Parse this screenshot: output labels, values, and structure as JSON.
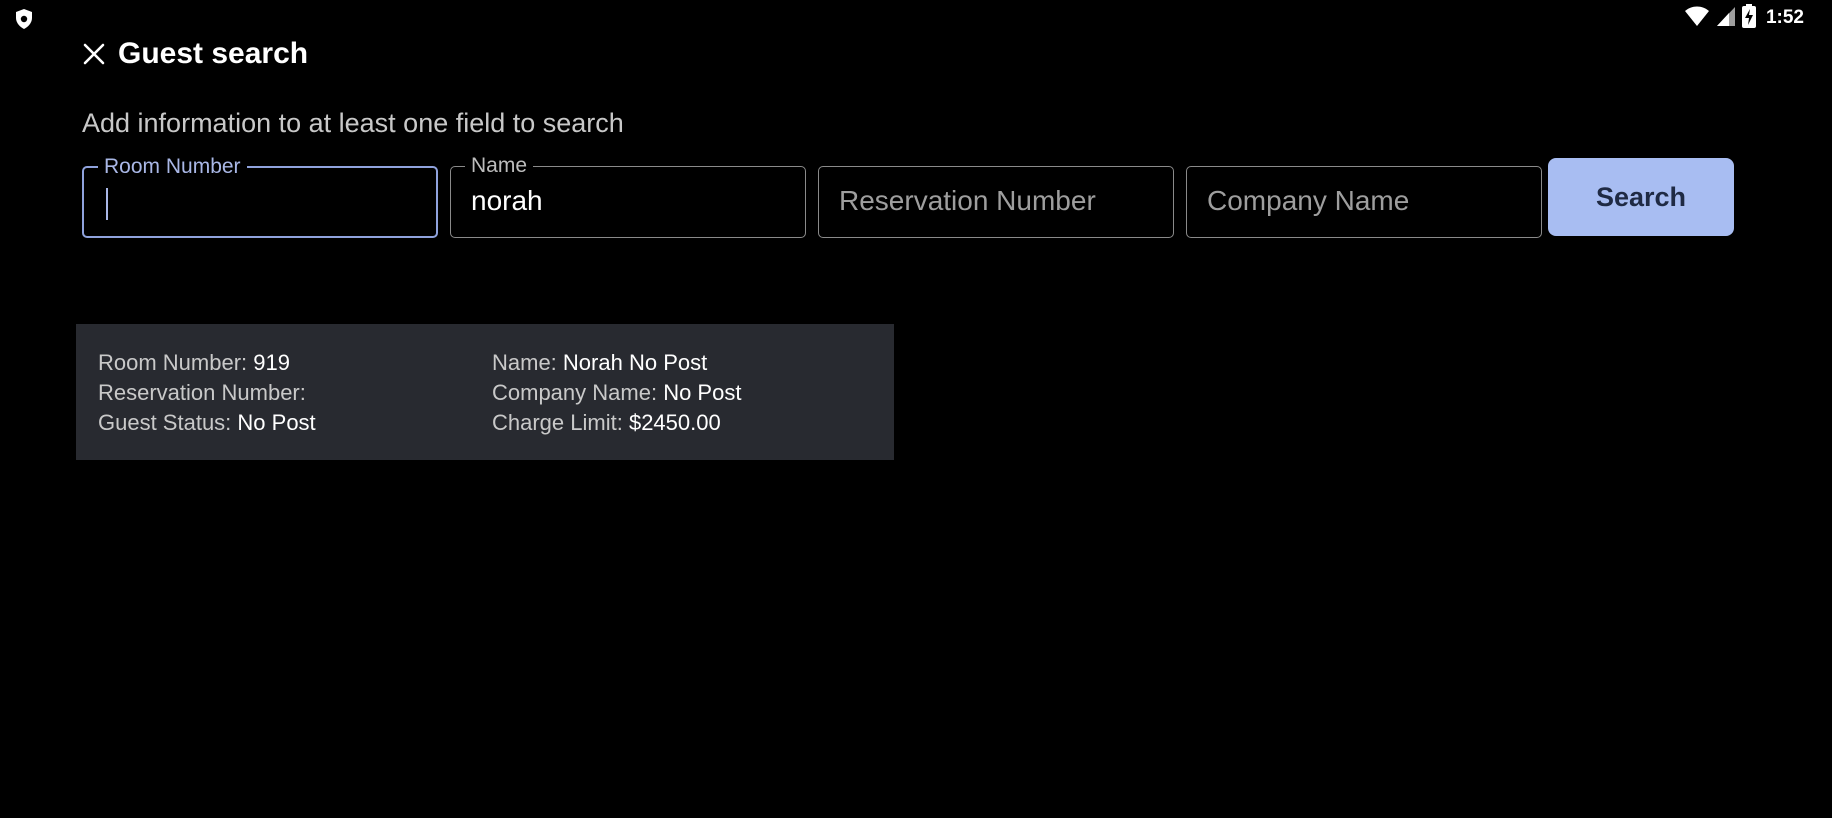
{
  "status_bar": {
    "left_icon": "shield-icon",
    "wifi_icon": "wifi-icon",
    "signal_icon": "cell-signal-icon",
    "battery_icon": "battery-charging-icon",
    "time": "1:52"
  },
  "header": {
    "close_icon": "close-icon",
    "title": "Guest search"
  },
  "instruction": "Add information to at least one field to search",
  "fields": {
    "room_number": {
      "label": "Room Number",
      "value": "",
      "placeholder": ""
    },
    "name": {
      "label": "Name",
      "value": "norah",
      "placeholder": ""
    },
    "reservation_number": {
      "label": "",
      "value": "",
      "placeholder": "Reservation Number"
    },
    "company_name": {
      "label": "",
      "value": "",
      "placeholder": "Company Name"
    }
  },
  "search_button": {
    "label": "Search"
  },
  "results": [
    {
      "room_number_label": "Room Number: ",
      "room_number": "919",
      "reservation_number_label": "Reservation Number:",
      "reservation_number": "",
      "guest_status_label": "Guest Status: ",
      "guest_status": "No Post",
      "name_label": "Name: ",
      "name": "Norah No Post",
      "company_name_label": "Company Name: ",
      "company_name": "No Post",
      "charge_limit_label": "Charge Limit: ",
      "charge_limit": "$2450.00"
    }
  ],
  "colors": {
    "background": "#000000",
    "accent": "#a8bdf2",
    "focused_border": "#8fa2dc",
    "card_background": "#282a30"
  }
}
